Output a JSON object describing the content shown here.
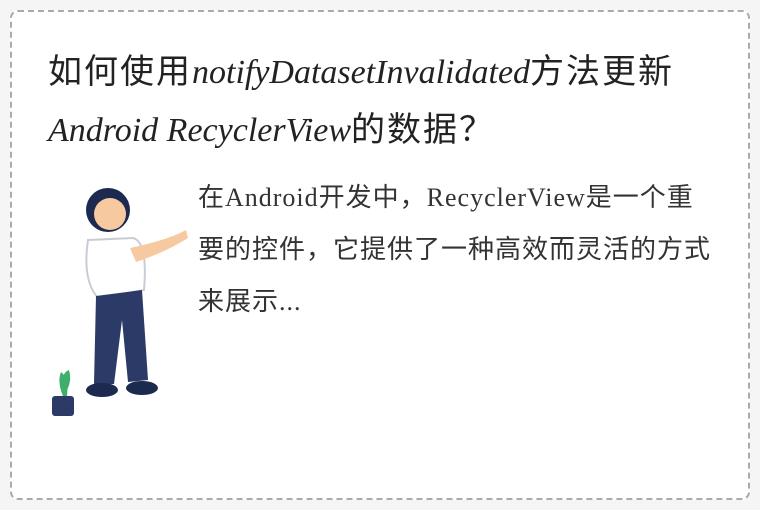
{
  "title_parts": {
    "p1": "如何使用",
    "p2": "notifyDatasetInvalidated",
    "p3": "方法更新",
    "p4": "Android RecyclerView",
    "p5": "的数据？"
  },
  "description": "在Android开发中，RecyclerView是一个重要的控件，它提供了一种高效而灵活的方式来展示..."
}
